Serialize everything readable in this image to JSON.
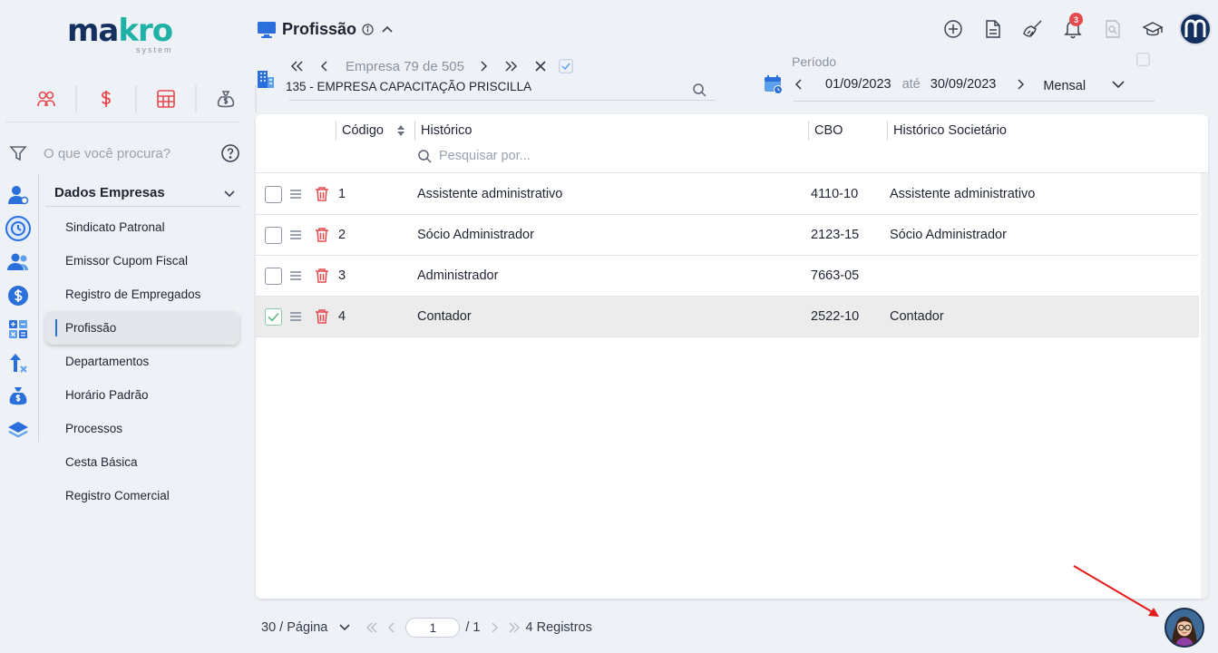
{
  "logo": {
    "word_main": "makro",
    "sub": "system"
  },
  "sidebar": {
    "search_placeholder": "O que você procura?",
    "group_title": "Dados Empresas",
    "items": [
      {
        "label": "Sindicato Patronal"
      },
      {
        "label": "Emissor Cupom Fiscal"
      },
      {
        "label": "Registro de Empregados"
      },
      {
        "label": "Profissão"
      },
      {
        "label": "Departamentos"
      },
      {
        "label": "Horário Padrão"
      },
      {
        "label": "Processos"
      },
      {
        "label": "Cesta Básica"
      },
      {
        "label": "Registro Comercial"
      }
    ]
  },
  "header": {
    "title": "Profissão",
    "notifications_count": "3"
  },
  "company": {
    "nav_text": "Empresa 79 de 505",
    "name": "135 - EMPRESA CAPACITAÇÃO PRISCILLA"
  },
  "period": {
    "label": "Período",
    "start": "01/09/2023",
    "separator": "até",
    "end": "30/09/2023",
    "mode": "Mensal"
  },
  "table": {
    "columns": [
      "Código",
      "Histórico",
      "CBO",
      "Histórico Societário"
    ],
    "filter_placeholder": "Pesquisar por...",
    "rows": [
      {
        "codigo": "1",
        "historico": "Assistente administrativo",
        "cbo": "4110-10",
        "societario": "Assistente administrativo",
        "selected": false
      },
      {
        "codigo": "2",
        "historico": "Sócio Administrador",
        "cbo": "2123-15",
        "societario": "Sócio Administrador",
        "selected": false
      },
      {
        "codigo": "3",
        "historico": "Administrador",
        "cbo": "7663-05",
        "societario": "",
        "selected": false
      },
      {
        "codigo": "4",
        "historico": "Contador",
        "cbo": "2522-10",
        "societario": "Contador",
        "selected": true
      }
    ]
  },
  "footer": {
    "page_size": "30 / Página",
    "page": "1",
    "total_pages": "/ 1",
    "records": "4 Registros"
  },
  "colors": {
    "accent": "#2a6fdb",
    "danger": "#e5484d",
    "brand": "#13305e",
    "teal": "#1fb1a6"
  }
}
